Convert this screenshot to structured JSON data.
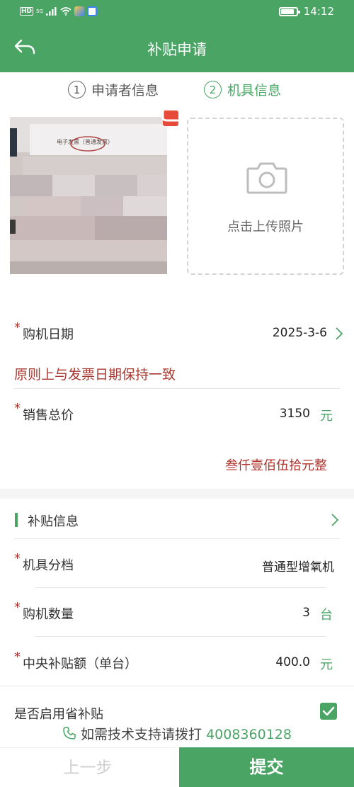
{
  "status_bar": {
    "hd": "HD",
    "network": "5G",
    "time": "14:12"
  },
  "header": {
    "title": "补贴申请",
    "back_icon": "back-arrow-icon"
  },
  "steps": [
    {
      "num": "1",
      "label": "申请者信息",
      "active": false
    },
    {
      "num": "2",
      "label": "机具信息",
      "active": true
    }
  ],
  "photos": {
    "uploaded_doc_heading": "电子发票（普通发票）",
    "upload_label": "点击上传照片"
  },
  "form": {
    "purchase_date": {
      "label": "购机日期",
      "value": "2025-3-6",
      "required": true
    },
    "date_hint": "原则上与发票日期保持一致",
    "total_price": {
      "label": "销售总价",
      "value": "3150",
      "unit": "元",
      "required": true
    },
    "total_price_words": "叁仟壹佰伍拾元整"
  },
  "subsidy": {
    "section_title": "补贴信息",
    "category": {
      "label": "机具分档",
      "value": "普通型增氧机",
      "required": true
    },
    "quantity": {
      "label": "购机数量",
      "value": "3",
      "unit": "台",
      "required": true
    },
    "central_amount": {
      "label": "中央补贴额（单台）",
      "value": "400.0",
      "unit": "元",
      "required": true
    },
    "provincial": {
      "label": "是否启用省补贴",
      "checked": true
    }
  },
  "support": {
    "text": "如需技术支持请拨打",
    "phone": "4008360128"
  },
  "buttons": {
    "prev": "上一步",
    "submit": "提交"
  },
  "colors": {
    "brand": "#4aa565",
    "warning": "#b0342c"
  }
}
